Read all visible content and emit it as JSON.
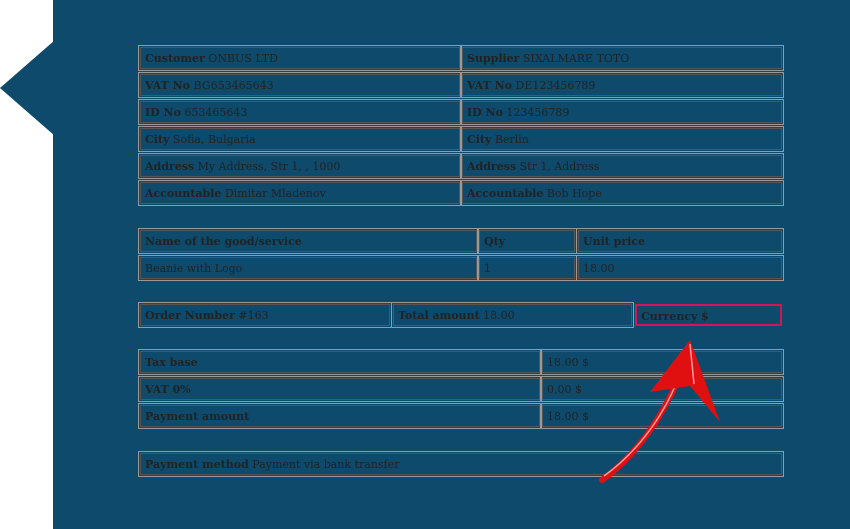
{
  "customer": {
    "customer": {
      "label": "Customer",
      "value": "ONBUS LTD"
    },
    "vat": {
      "label": "VAT No",
      "value": "BG653465643"
    },
    "id": {
      "label": "ID No",
      "value": "653465643"
    },
    "city": {
      "label": "City",
      "value": "Sofia, Bulgaria"
    },
    "address": {
      "label": "Address",
      "value": "My Address, Str 1, , 1000"
    },
    "accountable": {
      "label": "Accountable",
      "value": "Dimitar Mladenov"
    }
  },
  "supplier": {
    "supplier": {
      "label": "Supplier",
      "value": "SIXALMARE TOTO"
    },
    "vat": {
      "label": "VAT No",
      "value": "DE123456789"
    },
    "id": {
      "label": "ID No",
      "value": "123456789"
    },
    "city": {
      "label": "City",
      "value": "Berlin"
    },
    "address": {
      "label": "Address",
      "value": "Str 1, Address"
    },
    "accountable": {
      "label": "Accountable",
      "value": "Bob Hope"
    }
  },
  "goods": {
    "headers": [
      "Name of the good/service",
      "Qty",
      "Unit price"
    ],
    "rows": [
      [
        "Beanie with Logo",
        "1",
        "18.00"
      ]
    ]
  },
  "order": {
    "number_label": "Order Number",
    "number_value": "#163",
    "total_label": "Total amount",
    "total_value": "18.00",
    "currency_label": "Currency",
    "currency_value": "$"
  },
  "totals": [
    {
      "label": "Tax base",
      "value": "18.00 $"
    },
    {
      "label": "VAT 0%",
      "value": "0.00 $"
    },
    {
      "label": "Payment amount",
      "value": "18.00 $"
    }
  ],
  "payment": {
    "label": "Payment method",
    "value": "Payment via bank transfer"
  },
  "colors": {
    "frame": "#0d4a6b",
    "highlight": "#d4145a",
    "arrow": "#e01010"
  }
}
